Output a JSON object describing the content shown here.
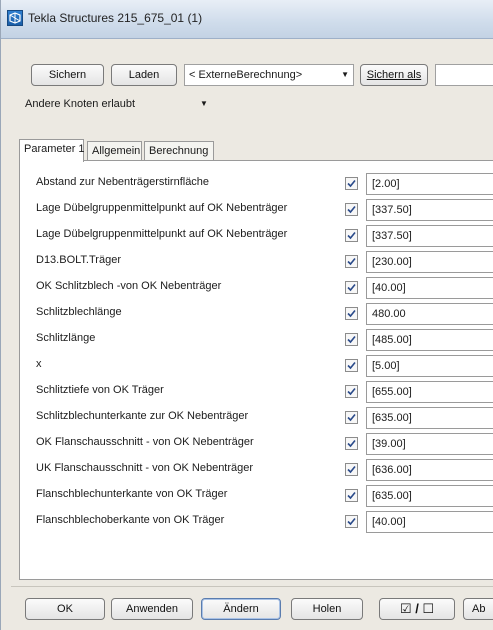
{
  "window": {
    "title": "Tekla Structures  215_675_01 (1)"
  },
  "toolbar": {
    "save_label": "Sichern",
    "load_label": "Laden",
    "preset_value": "< ExterneBerechnung>",
    "save_as_label": "Sichern als",
    "save_as_value": ""
  },
  "nodes_dropdown": {
    "value": "Andere Knoten erlaubt"
  },
  "tabs": [
    {
      "label": "Parameter 1",
      "active": true
    },
    {
      "label": "Allgemein",
      "active": false
    },
    {
      "label": "Berechnung",
      "active": false
    }
  ],
  "parameters": [
    {
      "label": "Abstand zur Nebenträgerstirnfläche",
      "checked": true,
      "value": "[2.00]"
    },
    {
      "label": "Lage Dübelgruppenmittelpunkt auf OK Nebenträger",
      "checked": true,
      "value": "[337.50]"
    },
    {
      "label": "Lage Dübelgruppenmittelpunkt auf OK Nebenträger",
      "checked": true,
      "value": "[337.50]"
    },
    {
      "label": "D13.BOLT.Träger",
      "checked": true,
      "value": "[230.00]"
    },
    {
      "label": "OK Schlitzblech -von OK Nebenträger",
      "checked": true,
      "value": "[40.00]"
    },
    {
      "label": "Schlitzblechlänge",
      "checked": true,
      "value": "480.00"
    },
    {
      "label": "Schlitzlänge",
      "checked": true,
      "value": "[485.00]"
    },
    {
      "label": "x",
      "checked": true,
      "value": "[5.00]"
    },
    {
      "label": "Schlitztiefe von OK Träger",
      "checked": true,
      "value": "[655.00]"
    },
    {
      "label": "Schlitzblechunterkante zur OK Nebenträger",
      "checked": true,
      "value": "[635.00]"
    },
    {
      "label": "OK Flanschausschnitt - von OK Nebenträger",
      "checked": true,
      "value": "[39.00]"
    },
    {
      "label": "UK Flanschausschnitt - von OK Nebenträger",
      "checked": true,
      "value": "[636.00]"
    },
    {
      "label": "Flanschblechunterkante von OK Träger",
      "checked": true,
      "value": "[635.00]"
    },
    {
      "label": "Flanschblechoberkante von OK Träger",
      "checked": true,
      "value": "[40.00]"
    }
  ],
  "footer": {
    "ok_label": "OK",
    "apply_label": "Anwenden",
    "modify_label": "Ändern",
    "get_label": "Holen",
    "toggle_label": "☑ / ☐",
    "cancel_partial_label": "Ab"
  }
}
